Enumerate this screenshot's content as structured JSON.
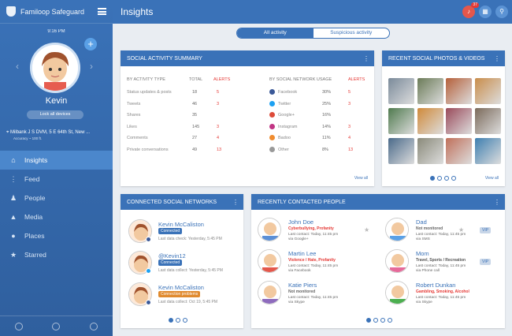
{
  "app": {
    "name": "Familoop Safeguard",
    "time": "9:16 PM",
    "child": "Kevin",
    "lock_label": "Lock all devices",
    "location": "Milbank J S DVM, 5 E 64th St, New ...",
    "accuracy": "Accuracy ~ 100 ft."
  },
  "nav": [
    "Insights",
    "Feed",
    "People",
    "Media",
    "Places",
    "Starred"
  ],
  "header": {
    "title": "Insights",
    "badge": "37"
  },
  "tabs": [
    "All activity",
    "Suspicious activity"
  ],
  "summary": {
    "title": "SOCIAL ACTIVITY SUMMARY",
    "h_type": "BY ACTIVITY TYPE",
    "h_total": "TOTAL",
    "h_alerts": "ALERTS",
    "h_net": "BY SOCIAL NETWORK USAGE",
    "h_alerts2": "ALERTS",
    "types": [
      [
        "Status updates & posts",
        "18",
        "5"
      ],
      [
        "Tweets",
        "46",
        "3"
      ],
      [
        "Shares",
        "35",
        ""
      ],
      [
        "Likes",
        "145",
        "3"
      ],
      [
        "Comments",
        "27",
        "4"
      ],
      [
        "Private conversations",
        "49",
        "13"
      ]
    ],
    "nets": [
      [
        "Facebook",
        "30%",
        "5"
      ],
      [
        "Twitter",
        "25%",
        "3"
      ],
      [
        "Google+",
        "16%",
        ""
      ],
      [
        "Instagram",
        "14%",
        "3"
      ],
      [
        "Badoo",
        "11%",
        "4"
      ],
      [
        "Other",
        "8%",
        "13"
      ]
    ],
    "view_all": "View all"
  },
  "photos": {
    "title": "RECENT SOCIAL PHOTOS & VIDEOS",
    "view_all": "View all"
  },
  "connected": {
    "title": "CONNECTED SOCIAL NETWORKS",
    "items": [
      [
        "Kevin McCaliston",
        "Connected",
        "Last data check: Yesterday, 5:45 PM"
      ],
      [
        "@Kevin12",
        "Connected",
        "Last data collect: Yesterday, 5:45 PM"
      ],
      [
        "Kevin McCaliston",
        "Connection problems",
        "Last data collect: Oct 19, 5:45 PM"
      ]
    ]
  },
  "people": {
    "title": "RECENTLY CONTACTED PEOPLE",
    "left": [
      [
        "John Doe",
        "Cyberbullying, Profanity",
        "Last contact: Today, 11:45 pm",
        "via Google+"
      ],
      [
        "Martin Lee",
        "Violence / Hate, Profanity",
        "Last contact: Today, 11:45 pm",
        "via Facebook"
      ],
      [
        "Katie Piers",
        "Not monitored",
        "Last contact: Today, 11:45 pm",
        "via Skype"
      ]
    ],
    "right": [
      [
        "Dad",
        "Not monitored",
        "Last contact: Today, 11:45 pm",
        "via SMS"
      ],
      [
        "Mom",
        "Travel, Sports / Recreation",
        "Last contact: Today, 11:45 pm",
        "via Phone call"
      ],
      [
        "Robert Dunkan",
        "Gambling, Smoking, Alcohol",
        "Last contact: Today, 11:45 pm",
        "via Skype"
      ]
    ],
    "vip": "VIP"
  }
}
